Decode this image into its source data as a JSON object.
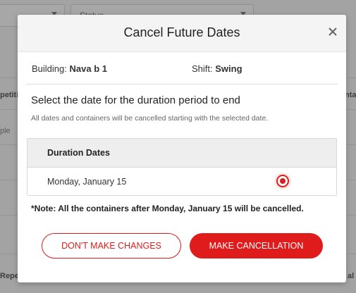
{
  "background": {
    "filter_status_label": "Status",
    "partial_left_header": "petitio",
    "partial_left_cell": "ple",
    "partial_right_header": "nta",
    "partial_left_footer": "Repet",
    "partial_right_footer": "al"
  },
  "modal": {
    "title": "Cancel Future Dates",
    "close_icon": "close-icon",
    "building_label": "Building:",
    "building_value": "Nava b 1",
    "shift_label": "Shift:",
    "shift_value": "Swing",
    "prompt": "Select the date for the duration period to end",
    "subtext": "All dates and containers will be cancelled starting with the selected date.",
    "table": {
      "header": "Duration Dates",
      "rows": [
        {
          "date": "Monday, January 15",
          "selected": true
        }
      ]
    },
    "note": "*Note: All the containers after Monday, January 15 will be cancelled.",
    "buttons": {
      "secondary": "DON'T MAKE CHANGES",
      "primary": "MAKE CANCELLATION"
    }
  },
  "colors": {
    "accent": "#e01b1b",
    "overlay": "#a3a3a3"
  }
}
